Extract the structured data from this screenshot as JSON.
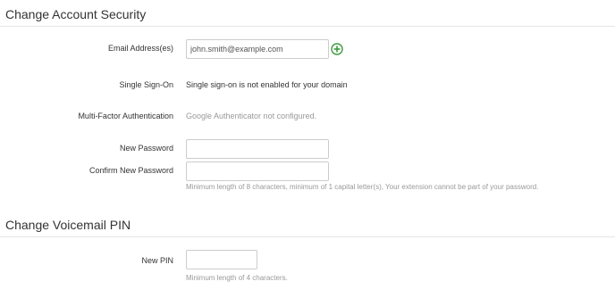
{
  "account_security": {
    "title": "Change Account Security",
    "email": {
      "label": "Email Address(es)",
      "value": "john.smith@example.com",
      "add_icon": "plus-circle-icon"
    },
    "sso": {
      "label": "Single Sign-On",
      "value": "Single sign-on is not enabled for your domain"
    },
    "mfa": {
      "label": "Multi-Factor Authentication",
      "value": "Google Authenticator not configured."
    },
    "new_password": {
      "label": "New Password",
      "value": ""
    },
    "confirm_password": {
      "label": "Confirm New Password",
      "value": "",
      "help": "Minimum length of 8 characters, minimum of 1 capital letter(s), Your extension cannot be part of your password."
    }
  },
  "voicemail_pin": {
    "title": "Change Voicemail PIN",
    "new_pin": {
      "label": "New PIN",
      "value": "",
      "help": "Minimum length of 4 characters."
    }
  },
  "colors": {
    "add_icon_green": "#3c9a3c",
    "muted_text": "#999999",
    "divider": "#e5e5e5"
  }
}
